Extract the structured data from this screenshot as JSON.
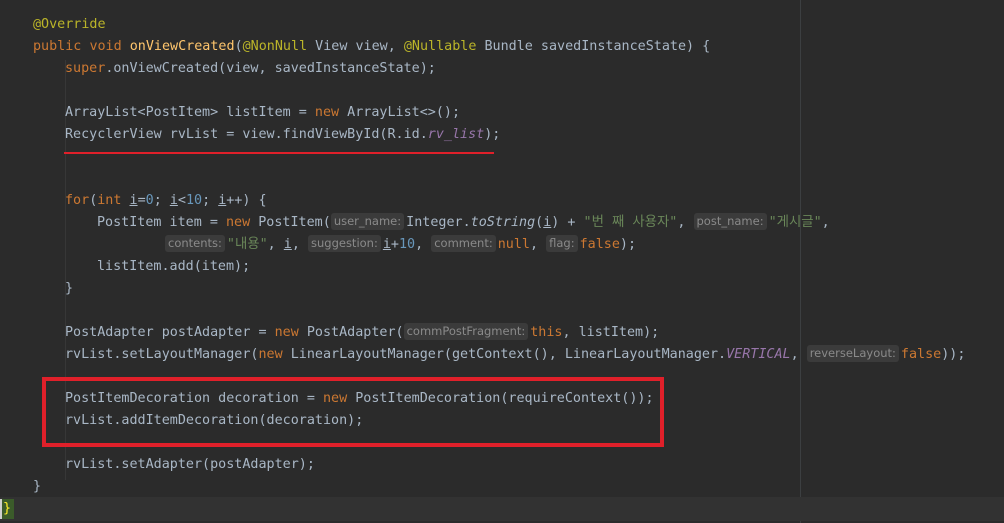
{
  "annotation_override": "@Override",
  "sig": {
    "kw_public": "public",
    "kw_void": "void",
    "method_name": "onViewCreated",
    "paren_open": "(",
    "ann_nonnull": "@NonNull",
    "param1": " View view, ",
    "ann_nullable": "@Nullable",
    "param2": " Bundle savedInstanceState) {"
  },
  "super_call": {
    "kw": "super",
    "rest": ".onViewCreated(view, savedInstanceState);"
  },
  "list_decl": {
    "type": "ArrayList<PostItem> listItem = ",
    "kw_new": "new",
    "rest": " ArrayList<>();"
  },
  "rv_decl": {
    "text": "RecyclerView rvList = view.findViewById(R.id.",
    "field": "rv_list",
    "end": ");"
  },
  "for_loop": {
    "kw_for": "for",
    "p1": "(",
    "kw_int": "int",
    "sp": " ",
    "var_i": "i",
    "eq": "=",
    "zero": "0",
    "semi1": "; ",
    "var_i2": "i",
    "lt": "<",
    "ten": "10",
    "semi2": "; ",
    "var_i3": "i",
    "inc": "++) {"
  },
  "item_line": {
    "text1": "PostItem item = ",
    "kw_new": "new",
    "text2": " PostItem(",
    "hint_user_name": "user_name:",
    "text3": "Integer.",
    "method": "toString",
    "paren": "(",
    "var_i": "i",
    "text4": ") + ",
    "str1": "\"번 째 사용자\"",
    "comma1": ", ",
    "hint_post_name": "post_name:",
    "str2": "\"게시글\"",
    "comma2": ","
  },
  "item_line2": {
    "hint_contents": "contents:",
    "str3": "\"내용\"",
    "comma1": ", ",
    "var_i": "i",
    "comma2": ", ",
    "hint_suggestion": "suggestion:",
    "var_i2": "i",
    "plus": "+",
    "ten": "10",
    "comma3": ", ",
    "hint_comment": "comment:",
    "kw_null": "null",
    "comma4": ", ",
    "hint_flag": "flag:",
    "kw_false": "false",
    "end": ");"
  },
  "add_item": "listItem.add(item);",
  "close_brace": "}",
  "adapter_line": {
    "text1": "PostAdapter postAdapter = ",
    "kw_new": "new",
    "text2": " PostAdapter(",
    "hint": "commPostFragment:",
    "kw_this": "this",
    "text3": ", listItem);"
  },
  "layout_line": {
    "text1": "rvList.setLayoutManager(",
    "kw_new": "new",
    "text2": " LinearLayoutManager(getContext(), LinearLayoutManager.",
    "field": "VERTICAL",
    "comma": ", ",
    "hint": "reverseLayout:",
    "kw_false": "false",
    "end": "));"
  },
  "decoration_line": {
    "text1": "PostItemDecoration decoration = ",
    "kw_new": "new",
    "text2": " PostItemDecoration(requireContext());"
  },
  "add_decoration": "rvList.addItemDecoration(decoration);",
  "set_adapter": "rvList.setAdapter(postAdapter);",
  "method_close": "}",
  "class_close": "}"
}
